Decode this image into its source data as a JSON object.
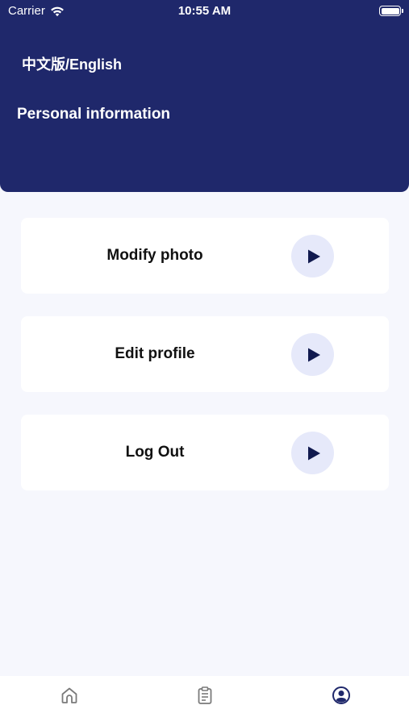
{
  "status_bar": {
    "carrier": "Carrier",
    "time": "10:55 AM",
    "wifi_icon": "wifi-icon",
    "battery_icon": "battery-icon"
  },
  "header": {
    "language_toggle": "中文版/English",
    "title": "Personal information"
  },
  "menu": {
    "items": [
      {
        "label": "Modify photo",
        "icon": "play-arrow-icon"
      },
      {
        "label": "Edit profile",
        "icon": "play-arrow-icon"
      },
      {
        "label": "Log Out",
        "icon": "play-arrow-icon"
      }
    ]
  },
  "tab_bar": {
    "tabs": [
      {
        "icon": "home-icon",
        "selected": false
      },
      {
        "icon": "clipboard-icon",
        "selected": false
      },
      {
        "icon": "profile-icon",
        "selected": true
      }
    ]
  },
  "colors": {
    "header_bg": "#1f286b",
    "page_bg": "#f6f7fd",
    "arrow_circle": "#e6e9fa",
    "arrow": "#111a4f",
    "tab_inactive": "#7a7a7a",
    "tab_active": "#1f286b"
  }
}
